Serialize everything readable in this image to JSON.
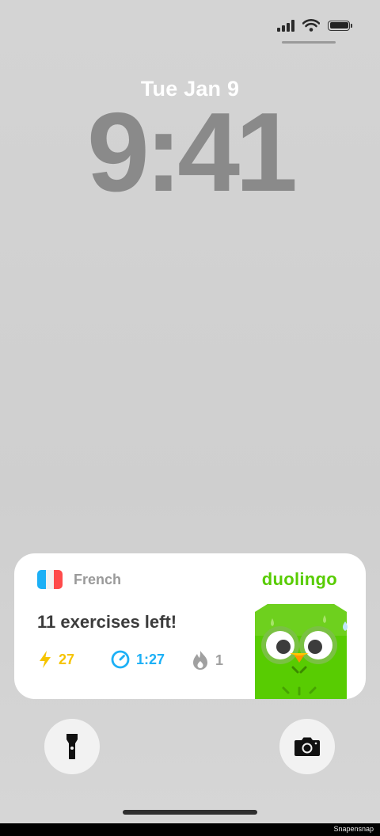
{
  "lock_screen": {
    "date": "Tue Jan 9",
    "time": "9:41"
  },
  "status_bar": {
    "icons": [
      "cellular-signal-icon",
      "wifi-icon",
      "battery-icon"
    ]
  },
  "widget": {
    "language": "French",
    "brand": "duolingo",
    "exercises_text": "11 exercises left!",
    "stats": {
      "xp": "27",
      "time": "1:27",
      "streak": "1"
    },
    "colors": {
      "brand_green": "#58cc02",
      "xp_yellow": "#f6c400",
      "time_blue": "#1cb0f6",
      "streak_gray": "#a0a0a0"
    }
  },
  "quick_actions": {
    "left_icon": "flashlight-icon",
    "right_icon": "camera-icon"
  },
  "footer": {
    "credit": "Snapensnap"
  }
}
